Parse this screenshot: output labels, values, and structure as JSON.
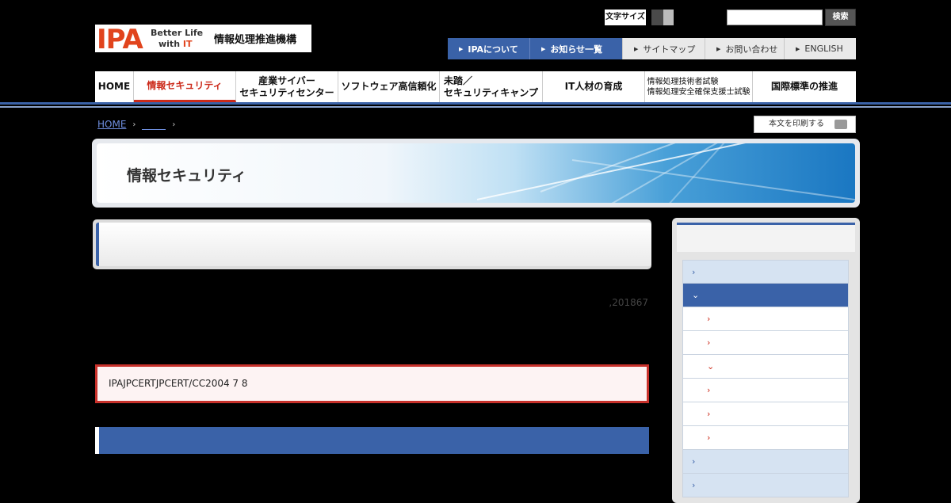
{
  "header": {
    "logo": {
      "mark": "IPA",
      "tagline_1": "Better Life",
      "tagline_2a": "with ",
      "tagline_2b": "IT",
      "org_name": "情報処理推進機構"
    },
    "font_size_label": "文字サイズ",
    "search": {
      "placeholder": "",
      "button": "検索"
    },
    "util_nav": [
      {
        "label": "IPAについて",
        "style": "blue"
      },
      {
        "label": "お知らせ一覧",
        "style": "blue"
      },
      {
        "label": "サイトマップ",
        "style": "gray"
      },
      {
        "label": "お問い合わせ",
        "style": "gray"
      },
      {
        "label": "ENGLISH",
        "style": "gray"
      }
    ]
  },
  "global_nav": [
    {
      "line1": "HOME",
      "line2": ""
    },
    {
      "line1": "情報セキュリティ",
      "line2": "",
      "active": true
    },
    {
      "line1": "産業サイバー",
      "line2": "セキュリティセンター"
    },
    {
      "line1": "ソフトウェア高信頼化",
      "line2": ""
    },
    {
      "line1": "未踏／",
      "line2": "セキュリティキャンプ"
    },
    {
      "line1": "IT人材の育成",
      "line2": ""
    },
    {
      "line1": "情報処理技術者試験",
      "line2": "情報処理安全確保支援士試験",
      "small": true
    },
    {
      "line1": "国際標準の推進",
      "line2": ""
    }
  ],
  "breadcrumb": {
    "home": "HOME",
    "sep": "›"
  },
  "print_button": "本文を印刷する",
  "banner": {
    "title": "情報セキュリティ"
  },
  "content": {
    "date": ",201867",
    "notice": "IPAJPCERTJPCERT/CC2004  7  8"
  },
  "sidebar": {
    "items": [
      {
        "level": 1,
        "marker": "›"
      },
      {
        "level": 1,
        "marker": "⌄",
        "open": true
      },
      {
        "level": 2,
        "marker": "›"
      },
      {
        "level": 2,
        "marker": "›"
      },
      {
        "level": 2,
        "marker": "⌄"
      },
      {
        "level": 2,
        "marker": "›"
      },
      {
        "level": 2,
        "marker": "›"
      },
      {
        "level": 2,
        "marker": "›"
      },
      {
        "level": 1,
        "marker": "›"
      },
      {
        "level": 1,
        "marker": "›"
      }
    ]
  },
  "colors": {
    "brand_blue": "#3a62a8",
    "accent_red": "#cc2a1a",
    "logo_orange": "#e1441d"
  }
}
